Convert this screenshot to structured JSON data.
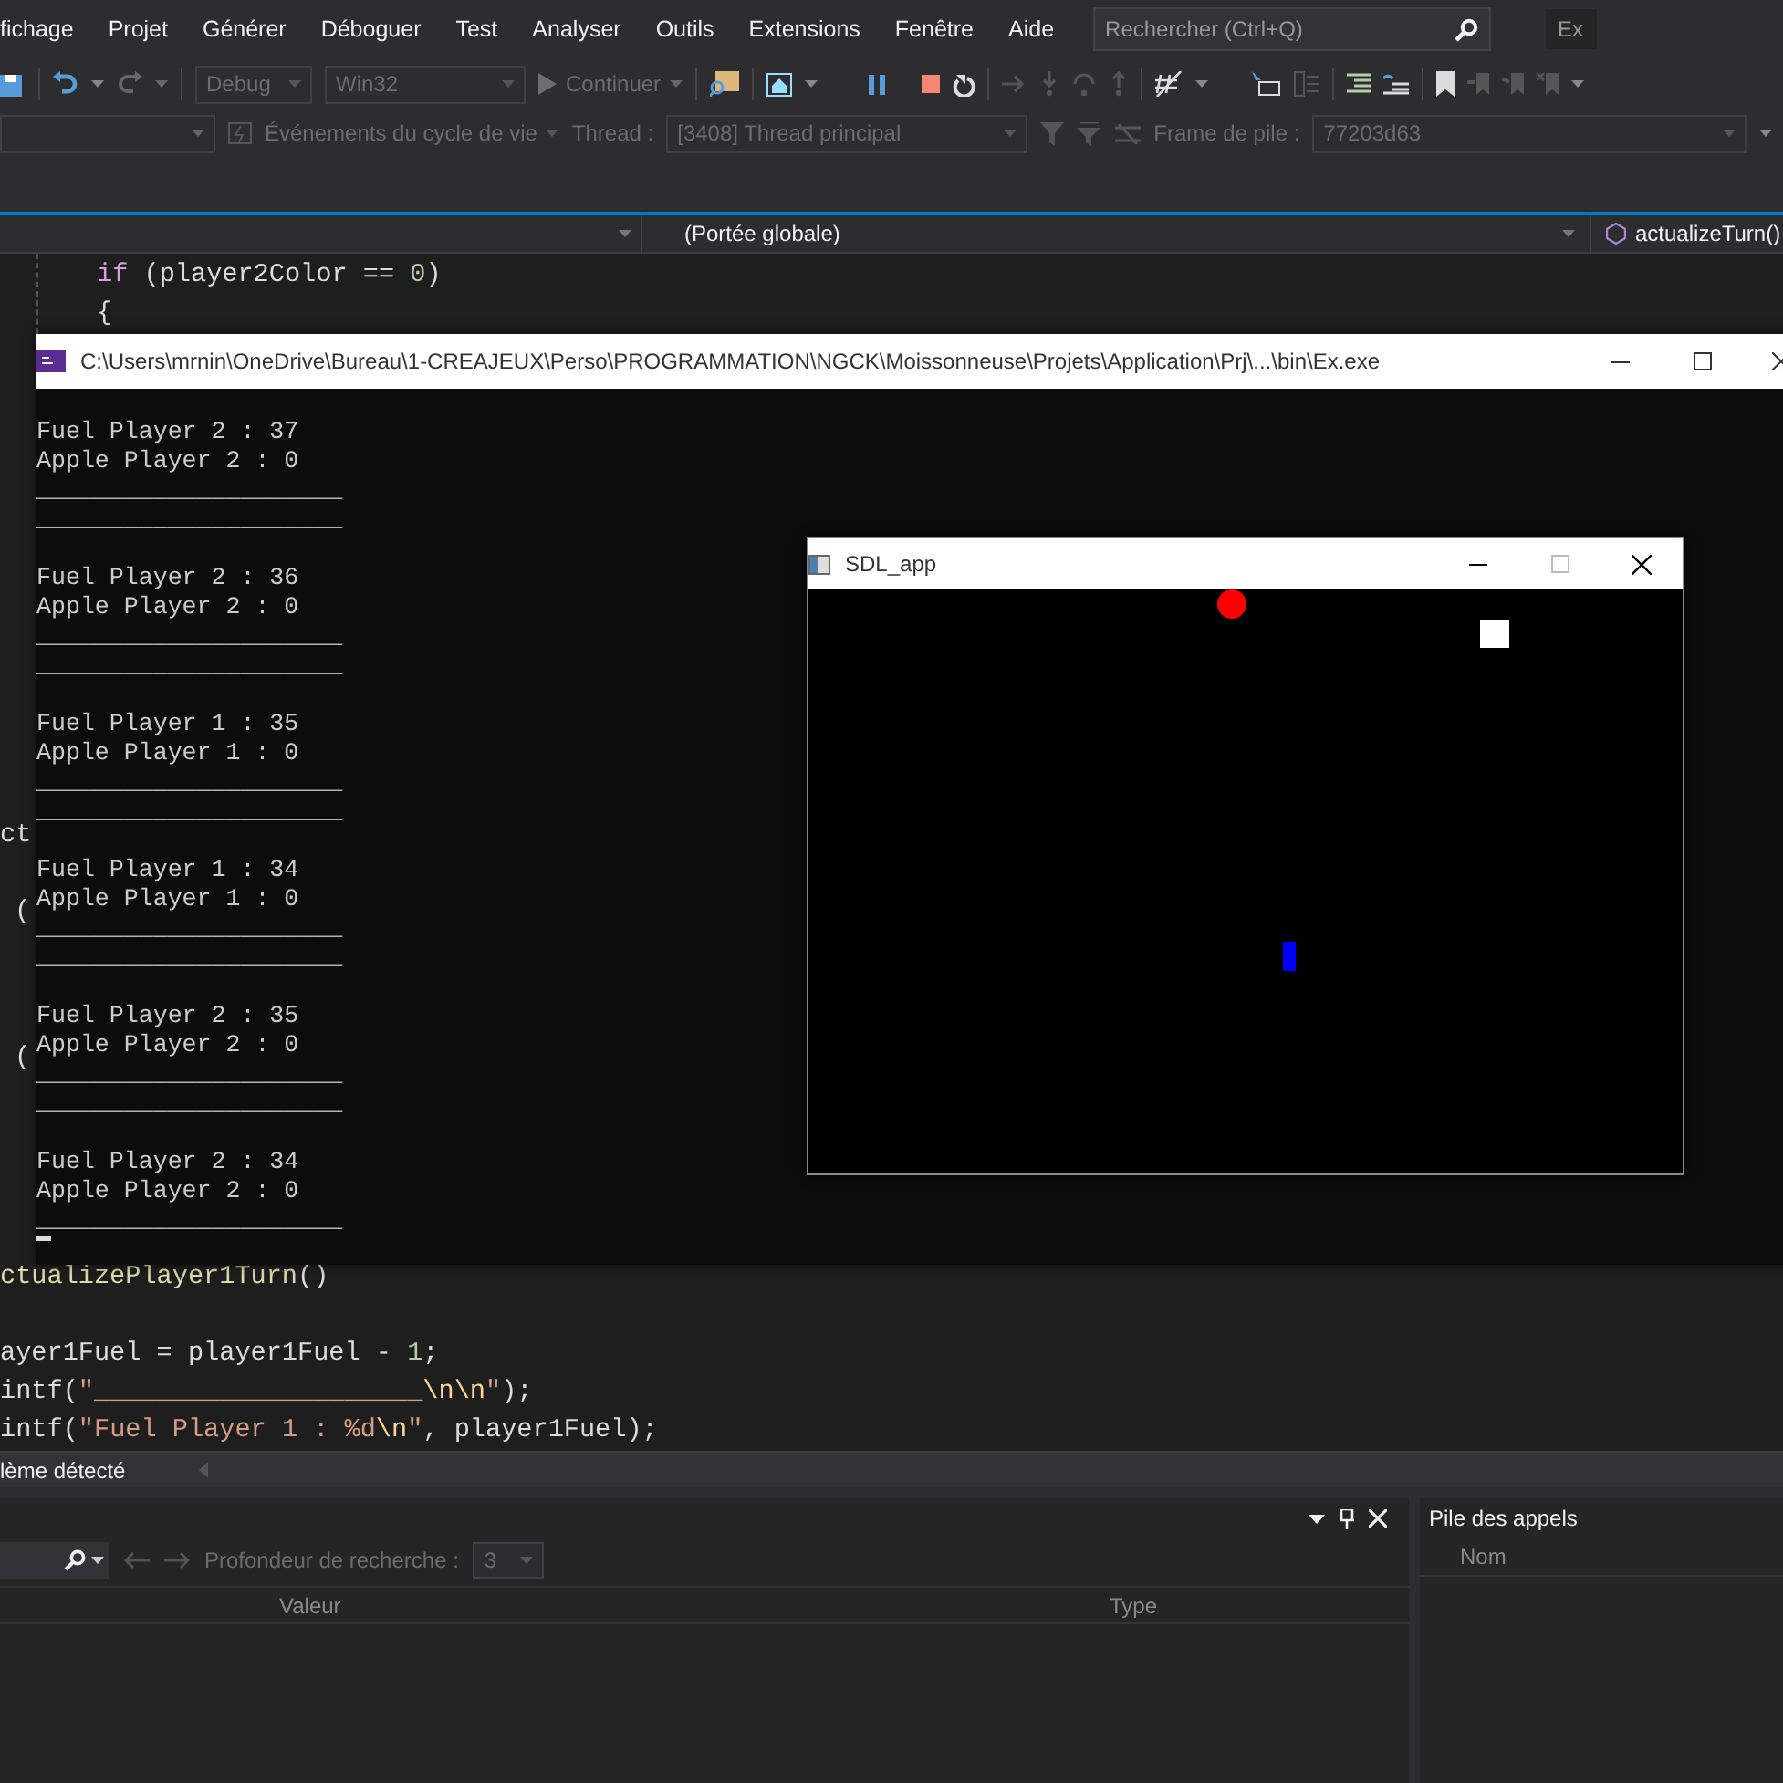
{
  "menu": {
    "items": [
      "fichage",
      "Projet",
      "Générer",
      "Déboguer",
      "Test",
      "Analyser",
      "Outils",
      "Extensions",
      "Fenêtre",
      "Aide"
    ],
    "search": {
      "placeholder": "Rechercher (Ctrl+Q)"
    },
    "badge": "Ex"
  },
  "toolbar": {
    "configuration": "Debug",
    "platform": "Win32",
    "continue": "Continuer"
  },
  "debug_location": {
    "lifecycle": "Événements du cycle de vie",
    "thread_label": "Thread :",
    "thread": "[3408] Thread principal",
    "frame_label": "Frame de pile :",
    "frame": "77203d63"
  },
  "navigation": {
    "scope": "(Portée globale)",
    "member": "actualizeTurn()"
  },
  "editor": {
    "top_lines": [
      [
        {
          "kind": "keyword",
          "text": "if"
        },
        {
          "kind": "plain",
          "text": " (player2Color == "
        },
        {
          "kind": "number",
          "text": "0"
        },
        {
          "kind": "plain",
          "text": ")"
        }
      ],
      [
        {
          "kind": "plain",
          "text": "{"
        }
      ]
    ],
    "fragments": [
      "ct",
      "(",
      "("
    ],
    "bottom_lines": [
      [
        {
          "kind": "function",
          "text": "ctualizePlayer1Turn"
        },
        {
          "kind": "plain",
          "text": "()"
        }
      ],
      [
        {
          "kind": "plain",
          "text": "ayer1Fuel = player1Fuel - "
        },
        {
          "kind": "number",
          "text": "1"
        },
        {
          "kind": "plain",
          "text": ";"
        }
      ],
      [
        {
          "kind": "plain",
          "text": "intf("
        },
        {
          "kind": "string",
          "text": "\"_____________________"
        },
        {
          "kind": "escape",
          "text": "\\n\\n"
        },
        {
          "kind": "string",
          "text": "\""
        },
        {
          "kind": "plain",
          "text": ");"
        }
      ],
      [
        {
          "kind": "plain",
          "text": "intf("
        },
        {
          "kind": "string",
          "text": "\"Fuel Player 1 : %d"
        },
        {
          "kind": "escape",
          "text": "\\n"
        },
        {
          "kind": "string",
          "text": "\""
        },
        {
          "kind": "plain",
          "text": ", player1Fuel);"
        }
      ]
    ]
  },
  "status": "lème détecté",
  "autos_panel": {
    "depth_label": "Profondeur de recherche :",
    "depth": "3",
    "columns": [
      "Valeur",
      "Type"
    ]
  },
  "call_stack_panel": {
    "title": "Pile des appels",
    "columns": [
      "Nom"
    ]
  },
  "console_window": {
    "title": "C:\\Users\\mrnin\\OneDrive\\Bureau\\1-CREAJEUX\\Perso\\PROGRAMMATION\\NGCK\\Moissonneuse\\Projets\\Application\\Prj\\...\\bin\\Ex.exe",
    "blocks": [
      [
        "Fuel Player 2 : 37",
        "Apple Player 2 : 0",
        "_____________________",
        "_____________________"
      ],
      [
        "Fuel Player 2 : 36",
        "Apple Player 2 : 0",
        "_____________________",
        "_____________________"
      ],
      [
        "Fuel Player 1 : 35",
        "Apple Player 1 : 0",
        "_____________________",
        "_____________________"
      ],
      [
        "Fuel Player 1 : 34",
        "Apple Player 1 : 0",
        "_____________________",
        "_____________________"
      ],
      [
        "Fuel Player 2 : 35",
        "Apple Player 2 : 0",
        "_____________________",
        "_____________________"
      ],
      [
        "Fuel Player 2 : 34",
        "Apple Player 2 : 0",
        "_____________________"
      ]
    ]
  },
  "sdl_window": {
    "title": "SDL_app"
  }
}
